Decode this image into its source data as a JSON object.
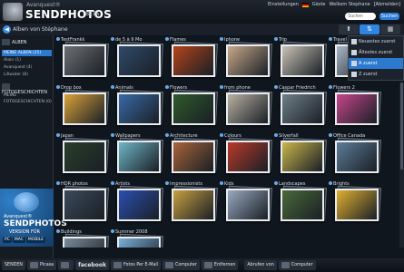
{
  "header": {
    "brand_small": "Avanquest®",
    "brand_big": "SENDPHOTOS",
    "brand_beta": "BETA",
    "links": [
      "Einstellungen",
      "Gäste",
      "Welkom Stephane",
      "[Abmelden]"
    ],
    "search_placeholder": "Suchen",
    "search_button": "Suchen"
  },
  "breadcrumb": {
    "back_icon": "arrow-left-icon",
    "text": "Alben von Stéphane"
  },
  "sidebar": {
    "albums_title": "ALBEN",
    "albums": [
      {
        "label": "MEINE ALBEN (25)",
        "selected": true
      },
      {
        "label": "Alain (1)",
        "selected": false
      },
      {
        "label": "Avanquest (4)",
        "selected": false
      },
      {
        "label": "Lillwater (8)",
        "selected": false
      }
    ],
    "stories_title": "FOTOGESCHICHTEN",
    "stories": [
      {
        "label": "MEINE FOTOGESCHICHTEN (0)"
      }
    ],
    "promo": {
      "line1": "Avanquest®",
      "line2": "SENDPHOTOS",
      "line3": "VERSION FÜR",
      "platforms": [
        "PC",
        "MAC",
        "MOBILE"
      ]
    }
  },
  "sort_menu": [
    {
      "label": "Neuestes zuerst",
      "selected": false
    },
    {
      "label": "Ältestes zuerst",
      "selected": false
    },
    {
      "label": "A zuerst",
      "selected": true
    },
    {
      "label": "Z zuerst",
      "selected": false
    }
  ],
  "albums": [
    {
      "title": "TestFrankk",
      "color": "#6d6f72"
    },
    {
      "title": "de 5 à 9 Mo",
      "color": "#2f4a6a"
    },
    {
      "title": "Flames",
      "color": "#b3441a"
    },
    {
      "title": "Iphone",
      "color": "#c9a98a"
    },
    {
      "title": "Trip",
      "color": "#c9c3b6"
    },
    {
      "title": "Travel",
      "color": "#a8b6c4"
    },
    {
      "title": "Drop box",
      "color": "#d9a23a"
    },
    {
      "title": "Animals",
      "color": "#3a6aa8"
    },
    {
      "title": "Flowers",
      "color": "#2f5a2a"
    },
    {
      "title": "from phone",
      "color": "#b9b1a3"
    },
    {
      "title": "Caspar Friedrich",
      "color": "#6f7f88"
    },
    {
      "title": "Flowers 2",
      "color": "#c5468a"
    },
    {
      "title": "Japan",
      "color": "#2a3e2a"
    },
    {
      "title": "Wallpapers",
      "color": "#6fb6c6"
    },
    {
      "title": "Architecture",
      "color": "#a8643a"
    },
    {
      "title": "Colours",
      "color": "#b93a2a"
    },
    {
      "title": "Silverfall",
      "color": "#c9b64a"
    },
    {
      "title": "Office Canada",
      "color": "#5d7d98"
    },
    {
      "title": "HDR photos",
      "color": "#3b4a5a"
    },
    {
      "title": "Artists",
      "color": "#2b4fb0"
    },
    {
      "title": "Impressionists",
      "color": "#c8a040"
    },
    {
      "title": "Kids",
      "color": "#9aa9c0"
    },
    {
      "title": "Landscapes",
      "color": "#4a6a3a"
    },
    {
      "title": "Brights",
      "color": "#e0b030"
    },
    {
      "title": "Buildings",
      "color": "#7a8a9a"
    },
    {
      "title": "Summer 2008",
      "color": "#7ab0d8"
    }
  ],
  "footer": {
    "send_label": "SENDEN",
    "buttons": [
      "Picasa",
      "",
      "facebook",
      "Fotos Per E-Mail",
      "Computer",
      "Entfernen"
    ],
    "import_label": "Abrufen von",
    "import_button": "Computer"
  }
}
